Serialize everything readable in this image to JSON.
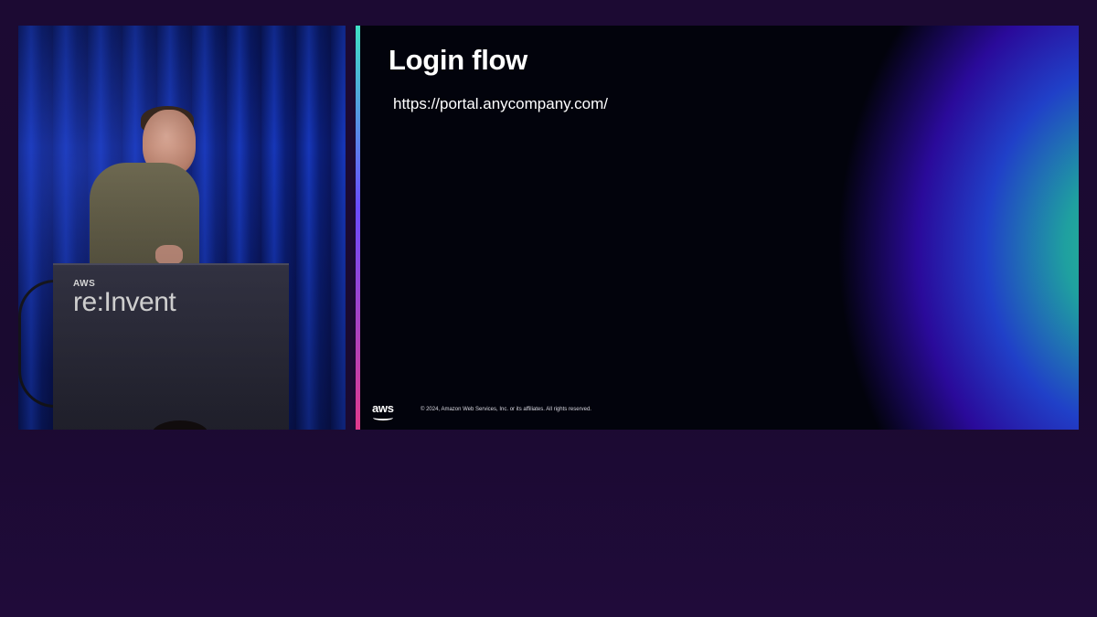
{
  "camera": {
    "logo": {
      "brand": "AWS",
      "event": "re:Invent"
    }
  },
  "slide": {
    "title": "Login flow",
    "url": "https://portal.anycompany.com/",
    "footer": {
      "aws_mark": "aws",
      "copyright": "© 2024, Amazon Web Services, Inc. or its affiliates. All rights reserved."
    }
  },
  "colors": {
    "background": "#1c0a33",
    "slide_background": "#02030c",
    "accent_teal": "#2ec48a",
    "accent_blue": "#2040c8",
    "accent_purple": "#2a0a9a"
  }
}
